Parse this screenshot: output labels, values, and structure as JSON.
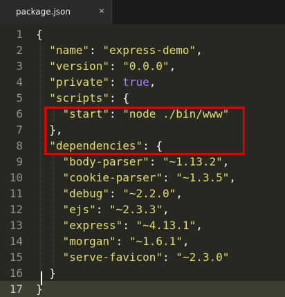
{
  "tab": {
    "title": "package.json",
    "close_glyph": "×"
  },
  "editor": {
    "current_line": 17,
    "lines": [
      {
        "n": "1",
        "tokens": [
          {
            "t": "{",
            "c": "p"
          }
        ]
      },
      {
        "n": "2",
        "tokens": [
          {
            "t": "  ",
            "c": "p"
          },
          {
            "t": "\"name\"",
            "c": "s"
          },
          {
            "t": ": ",
            "c": "p"
          },
          {
            "t": "\"express-demo\"",
            "c": "s"
          },
          {
            "t": ",",
            "c": "p"
          }
        ]
      },
      {
        "n": "3",
        "tokens": [
          {
            "t": "  ",
            "c": "p"
          },
          {
            "t": "\"version\"",
            "c": "s"
          },
          {
            "t": ": ",
            "c": "p"
          },
          {
            "t": "\"0.0.0\"",
            "c": "s"
          },
          {
            "t": ",",
            "c": "p"
          }
        ]
      },
      {
        "n": "4",
        "tokens": [
          {
            "t": "  ",
            "c": "p"
          },
          {
            "t": "\"private\"",
            "c": "s"
          },
          {
            "t": ": ",
            "c": "p"
          },
          {
            "t": "true",
            "c": "k"
          },
          {
            "t": ",",
            "c": "p"
          }
        ]
      },
      {
        "n": "5",
        "tokens": [
          {
            "t": "  ",
            "c": "p"
          },
          {
            "t": "\"scripts\"",
            "c": "s"
          },
          {
            "t": ": {",
            "c": "p"
          }
        ]
      },
      {
        "n": "6",
        "tokens": [
          {
            "t": "    ",
            "c": "p"
          },
          {
            "t": "\"start\"",
            "c": "s"
          },
          {
            "t": ": ",
            "c": "p"
          },
          {
            "t": "\"node ./bin/www\"",
            "c": "s"
          }
        ]
      },
      {
        "n": "7",
        "tokens": [
          {
            "t": "  },",
            "c": "p"
          }
        ]
      },
      {
        "n": "8",
        "tokens": [
          {
            "t": "  ",
            "c": "p"
          },
          {
            "t": "\"dependencies\"",
            "c": "s"
          },
          {
            "t": ": {",
            "c": "p"
          }
        ]
      },
      {
        "n": "9",
        "tokens": [
          {
            "t": "    ",
            "c": "p"
          },
          {
            "t": "\"body-parser\"",
            "c": "s"
          },
          {
            "t": ": ",
            "c": "p"
          },
          {
            "t": "\"~1.13.2\"",
            "c": "s"
          },
          {
            "t": ",",
            "c": "p"
          }
        ]
      },
      {
        "n": "10",
        "tokens": [
          {
            "t": "    ",
            "c": "p"
          },
          {
            "t": "\"cookie-parser\"",
            "c": "s"
          },
          {
            "t": ": ",
            "c": "p"
          },
          {
            "t": "\"~1.3.5\"",
            "c": "s"
          },
          {
            "t": ",",
            "c": "p"
          }
        ]
      },
      {
        "n": "11",
        "tokens": [
          {
            "t": "    ",
            "c": "p"
          },
          {
            "t": "\"debug\"",
            "c": "s"
          },
          {
            "t": ": ",
            "c": "p"
          },
          {
            "t": "\"~2.2.0\"",
            "c": "s"
          },
          {
            "t": ",",
            "c": "p"
          }
        ]
      },
      {
        "n": "12",
        "tokens": [
          {
            "t": "    ",
            "c": "p"
          },
          {
            "t": "\"ejs\"",
            "c": "s"
          },
          {
            "t": ": ",
            "c": "p"
          },
          {
            "t": "\"~2.3.3\"",
            "c": "s"
          },
          {
            "t": ",",
            "c": "p"
          }
        ]
      },
      {
        "n": "13",
        "tokens": [
          {
            "t": "    ",
            "c": "p"
          },
          {
            "t": "\"express\"",
            "c": "s"
          },
          {
            "t": ": ",
            "c": "p"
          },
          {
            "t": "\"~4.13.1\"",
            "c": "s"
          },
          {
            "t": ",",
            "c": "p"
          }
        ]
      },
      {
        "n": "14",
        "tokens": [
          {
            "t": "    ",
            "c": "p"
          },
          {
            "t": "\"morgan\"",
            "c": "s"
          },
          {
            "t": ": ",
            "c": "p"
          },
          {
            "t": "\"~1.6.1\"",
            "c": "s"
          },
          {
            "t": ",",
            "c": "p"
          }
        ]
      },
      {
        "n": "15",
        "tokens": [
          {
            "t": "    ",
            "c": "p"
          },
          {
            "t": "\"serve-favicon\"",
            "c": "s"
          },
          {
            "t": ": ",
            "c": "p"
          },
          {
            "t": "\"~2.3.0\"",
            "c": "s"
          }
        ]
      },
      {
        "n": "16",
        "tokens": [
          {
            "t": "  }",
            "c": "p"
          }
        ]
      },
      {
        "n": "17",
        "tokens": [
          {
            "t": "}",
            "c": "p"
          }
        ]
      }
    ]
  },
  "colors": {
    "background": "#272822",
    "string": "#e6db74",
    "constant": "#ae81ff",
    "punctuation": "#f8f8f2",
    "gutter_text": "#8f908a",
    "highlight_box": "#e00000"
  }
}
